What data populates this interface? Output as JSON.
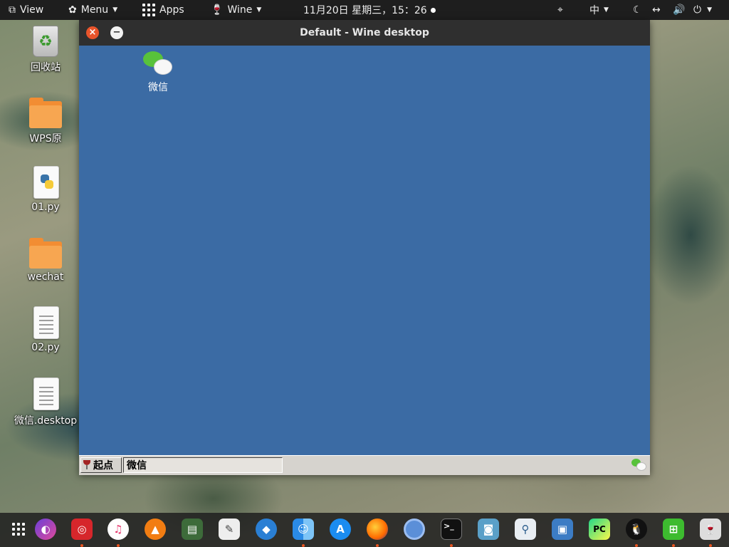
{
  "top_panel": {
    "view_label": "View",
    "menu_label": "Menu",
    "apps_label": "Apps",
    "wine_label": "Wine",
    "clock": "11月20日 星期三，15：26",
    "input_method": "中",
    "icons": [
      "window-icon",
      "gnome-foot-icon",
      "grid-icon",
      "wine-glass-icon",
      "location-icon",
      "night-light-icon",
      "network-icon",
      "volume-icon",
      "power-icon"
    ]
  },
  "desktop_icons": [
    {
      "label": "回收站",
      "icon": "trash-icon"
    },
    {
      "label": "WPS原",
      "icon": "folder-icon"
    },
    {
      "label": "01.py",
      "icon": "python-file-icon"
    },
    {
      "label": "wechat",
      "icon": "folder-icon"
    },
    {
      "label": "02.py",
      "icon": "text-file-icon"
    },
    {
      "label": "微信.desktop",
      "icon": "text-file-icon"
    }
  ],
  "window": {
    "title": "Default - Wine desktop",
    "close_glyph": "×",
    "minimize_glyph": "−",
    "desktop_icon_label": "微信",
    "taskbar": {
      "start_label": "起点",
      "task_label": "微信"
    }
  },
  "dock": {
    "apps": [
      "app-grid-icon",
      "browser-icon",
      "netease-music-icon",
      "itunes-icon",
      "vlc-icon",
      "stardict-icon",
      "text-editor-icon",
      "deepin-icon",
      "finder-icon",
      "app-store-icon",
      "firefox-icon",
      "chromium-icon",
      "terminal-icon",
      "screenshot-icon",
      "search-icon",
      "image-viewer-icon",
      "pycharm-icon",
      "qq-icon",
      "windows-icon",
      "wine-icon"
    ],
    "colors": {
      "accent": "#e95420",
      "desktop_blue": "#3b6ba4"
    }
  }
}
